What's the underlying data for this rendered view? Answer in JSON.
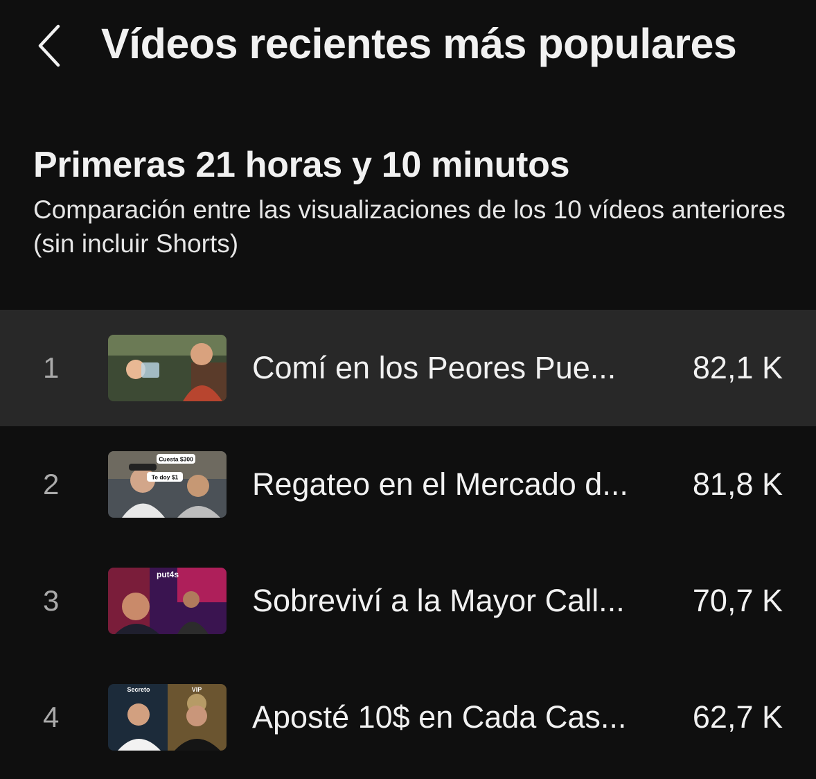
{
  "header": {
    "title": "Vídeos recientes más populares",
    "back_icon": "chevron-left-icon"
  },
  "section": {
    "heading": "Primeras 21 horas y 10 minutos",
    "subtitle": "Comparación entre las visualizaciones de los 10 vídeos anteriores (sin incluir Shorts)"
  },
  "videos": [
    {
      "rank": "1",
      "title": "Comí en los Peores Pue...",
      "views": "82,1 K",
      "selected": true,
      "thumb_colors": [
        "#6b7a55",
        "#b8452f"
      ],
      "thumb_text": []
    },
    {
      "rank": "2",
      "title": "Regateo en el Mercado d...",
      "views": "81,8 K",
      "selected": false,
      "thumb_colors": [
        "#5a5f63",
        "#c9c9c9"
      ],
      "thumb_text": [
        "Cuesta $300",
        "Te doy $1"
      ]
    },
    {
      "rank": "3",
      "title": "Sobreviví a la Mayor Call...",
      "views": "70,7 K",
      "selected": false,
      "thumb_colors": [
        "#5a1a6e",
        "#e0245e"
      ],
      "thumb_text": [
        "put4s"
      ]
    },
    {
      "rank": "4",
      "title": "Aposté 10$ en Cada Cas...",
      "views": "62,7 K",
      "selected": false,
      "thumb_colors": [
        "#1c2b3a",
        "#c9a55a"
      ],
      "thumb_text": [
        "Secreto",
        "VIP"
      ]
    }
  ]
}
